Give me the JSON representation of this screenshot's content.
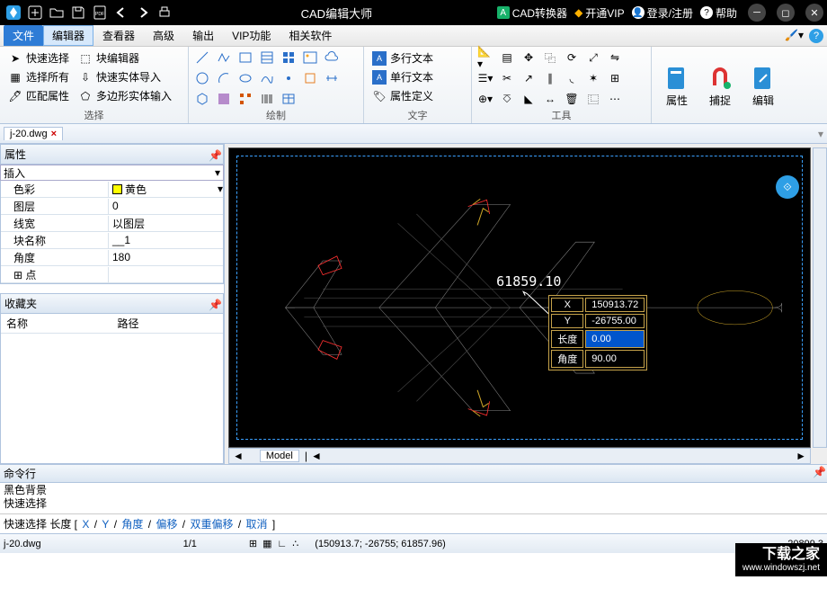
{
  "title": "CAD编辑大师",
  "titlebar_right": {
    "converter": "CAD转换器",
    "vip": "开通VIP",
    "login": "登录/注册",
    "help": "帮助"
  },
  "menu": [
    "文件",
    "编辑器",
    "查看器",
    "高级",
    "输出",
    "VIP功能",
    "相关软件"
  ],
  "ribbon": {
    "select": {
      "quick": "快速选择",
      "block": "块编辑器",
      "all": "选择所有",
      "fastimport": "快速实体导入",
      "match": "匹配属性",
      "poly": "多边形实体输入",
      "label": "选择"
    },
    "draw": {
      "label": "绘制"
    },
    "text": {
      "multi": "多行文本",
      "single": "单行文本",
      "attr": "属性定义",
      "label": "文字"
    },
    "tools": {
      "label": "工具"
    },
    "big": {
      "props": "属性",
      "snap": "捕捉",
      "edit": "编辑"
    }
  },
  "file_tab": "j-20.dwg",
  "panels": {
    "props_title": "属性",
    "insert": "插入",
    "rows": [
      {
        "k": "色彩",
        "v": "黄色",
        "chip": true,
        "dd": true
      },
      {
        "k": "图层",
        "v": "0"
      },
      {
        "k": "线宽",
        "v": "以图层"
      },
      {
        "k": "块名称",
        "v": "__1"
      },
      {
        "k": "角度",
        "v": "180"
      },
      {
        "k": "点",
        "v": "",
        "exp": true
      }
    ],
    "fav_title": "收藏夹",
    "fav_cols": [
      "名称",
      "路径"
    ]
  },
  "canvas": {
    "dim": "61859.10",
    "coords": [
      {
        "k": "X",
        "v": "150913.72"
      },
      {
        "k": "Y",
        "v": "-26755.00"
      },
      {
        "k": "长度",
        "v": "0.00",
        "blue": true
      },
      {
        "k": "角度",
        "v": "90.00"
      }
    ],
    "model_tab": "Model"
  },
  "cmd": {
    "title": "命令行",
    "lines": [
      "黑色背景",
      "快速选择"
    ],
    "prompt_pre": "快速选择 长度 [ ",
    "links": [
      "X",
      "Y",
      "角度",
      "偏移",
      "双重偏移",
      "取消"
    ],
    "prompt_post": " ]"
  },
  "status": {
    "file": "j-20.dwg",
    "page": "1/1",
    "coords": "(150913.7; -26755; 61857.96)",
    "right": "20899.3"
  },
  "watermark": {
    "big": "下载之家",
    "url": "www.windowszj.net"
  }
}
